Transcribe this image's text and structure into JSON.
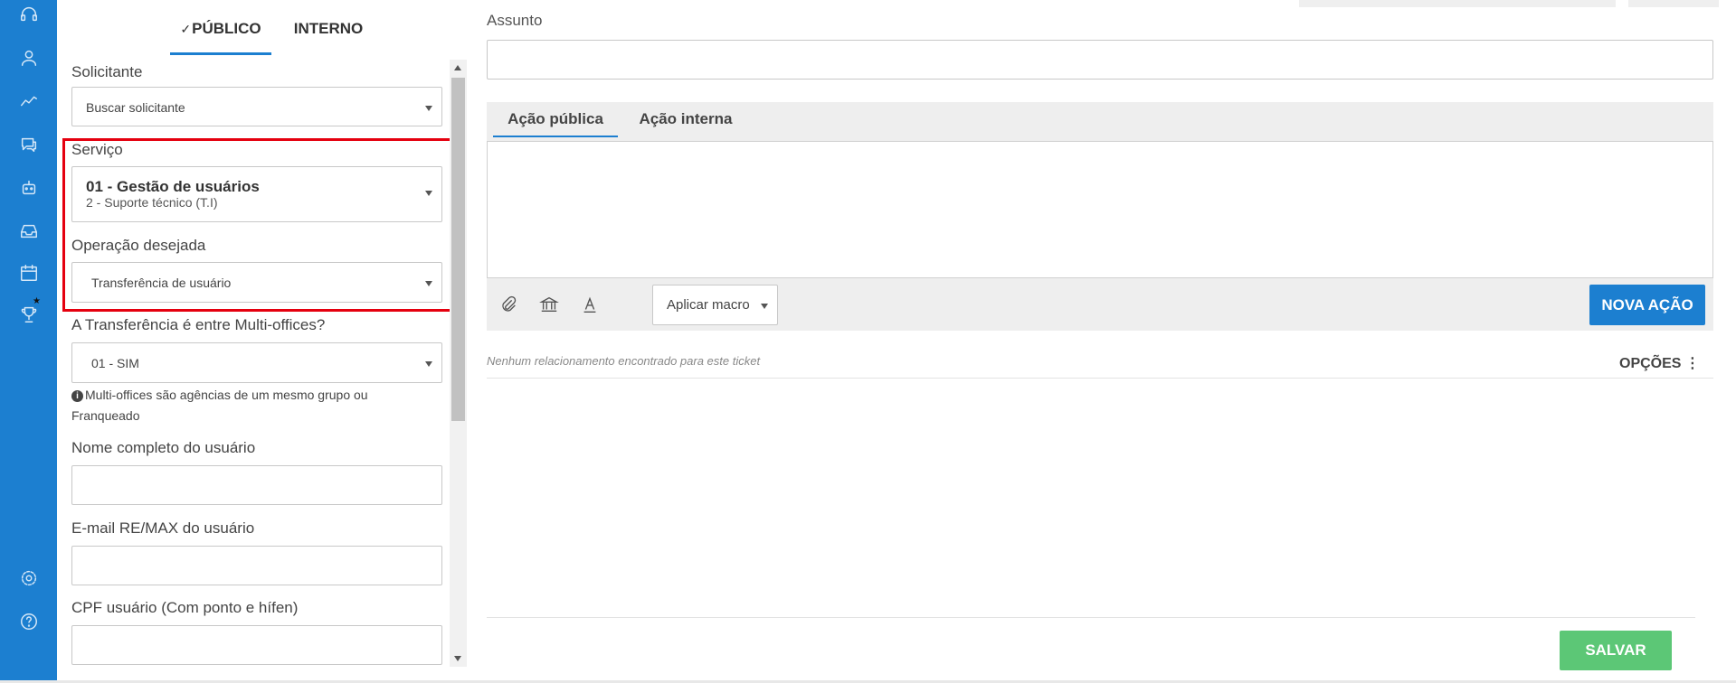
{
  "sidebar": {
    "icons": [
      "headset-icon",
      "user-icon",
      "chart-line-icon",
      "chat-icon",
      "robot-icon",
      "inbox-icon",
      "calendar-icon",
      "trophy-icon",
      "settings-icon",
      "help-icon"
    ]
  },
  "left": {
    "tabs": {
      "public": "PÚBLICO",
      "internal": "INTERNO",
      "check": "✓"
    },
    "solicitante": {
      "label": "Solicitante",
      "value": "Buscar solicitante"
    },
    "servico": {
      "label": "Serviço",
      "value": "01 - Gestão de usuários",
      "sub": "2 - Suporte técnico (T.I)"
    },
    "operacao": {
      "label": "Operação desejada",
      "value": "Transferência de usuário"
    },
    "multioffice": {
      "label": "A Transferência é entre Multi-offices?",
      "value": "01 - SIM",
      "help": "Multi-offices são agências de um mesmo grupo ou Franqueado"
    },
    "nome": {
      "label": "Nome completo do usuário",
      "value": ""
    },
    "email": {
      "label": "E-mail RE/MAX do usuário",
      "value": ""
    },
    "cpf": {
      "label": "CPF usuário (Com ponto e hífen)",
      "value": ""
    }
  },
  "right": {
    "assunto": {
      "label": "Assunto",
      "value": ""
    },
    "editor": {
      "tab_public": "Ação pública",
      "tab_internal": "Ação interna",
      "macro": "Aplicar macro",
      "new_action": "NOVA AÇÃO"
    },
    "no_relation": "Nenhum relacionamento encontrado para este ticket",
    "options": "OPÇÕES ⋮",
    "save": "SALVAR"
  },
  "colors": {
    "primary": "#1c7fd0",
    "save": "#5cc776",
    "highlight": "#e5000f"
  }
}
